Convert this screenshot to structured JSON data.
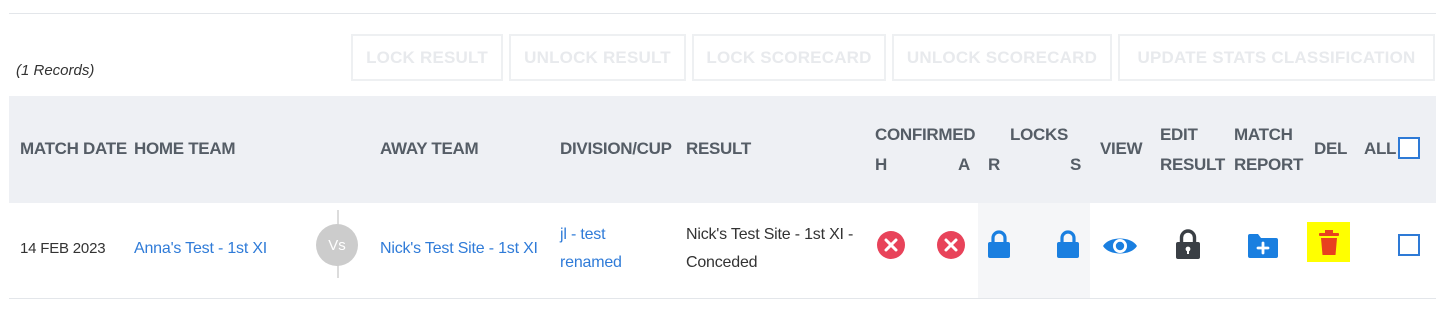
{
  "records_label": "(1 Records)",
  "actions": {
    "lock_result": "LOCK RESULT",
    "unlock_result": "UNLOCK RESULT",
    "lock_scorecard": "LOCK SCORECARD",
    "unlock_scorecard": "UNLOCK SCORECARD",
    "update_stats": "UPDATE STATS CLASSIFICATION"
  },
  "headers": {
    "match_date": "MATCH DATE",
    "home_team": "HOME TEAM",
    "away_team": "AWAY TEAM",
    "division_cup": "DIVISION/CUP",
    "result": "RESULT",
    "confirmed": "CONFIRMED",
    "confirmed_h": "H",
    "confirmed_a": "A",
    "locks": "LOCKS",
    "locks_r": "R",
    "locks_s": "S",
    "view": "VIEW",
    "edit_1": "EDIT",
    "edit_2": "RESULT",
    "report_1": "MATCH",
    "report_2": "REPORT",
    "del": "DEL",
    "all": "ALL"
  },
  "rows": [
    {
      "match_date": "14 FEB 2023",
      "home_team": "Anna's Test - 1st XI",
      "vs": "Vs",
      "away_team": "Nick's Test Site - 1st XI",
      "division_1": "jl - test",
      "division_2": "renamed",
      "result_1": "Nick's Test Site - 1st XI -",
      "result_2": "Conceded",
      "confirmed_h": "not-confirmed",
      "confirmed_a": "not-confirmed",
      "lock_r": "locked",
      "lock_s": "locked"
    }
  ],
  "colors": {
    "link": "#2f7bd8",
    "icon_blue": "#1a7fe0",
    "cross_red": "#e8435a",
    "delete_highlight": "#ffff00",
    "delete_icon": "#e8401f",
    "edit_lock": "#3a3f45"
  },
  "icons": {
    "confirmed_h": "x-circle-icon",
    "confirmed_a": "x-circle-icon",
    "lock_r": "lock-icon",
    "lock_s": "lock-icon",
    "view": "eye-icon",
    "edit": "lock-icon",
    "report": "folder-plus-icon",
    "del": "trash-icon"
  }
}
